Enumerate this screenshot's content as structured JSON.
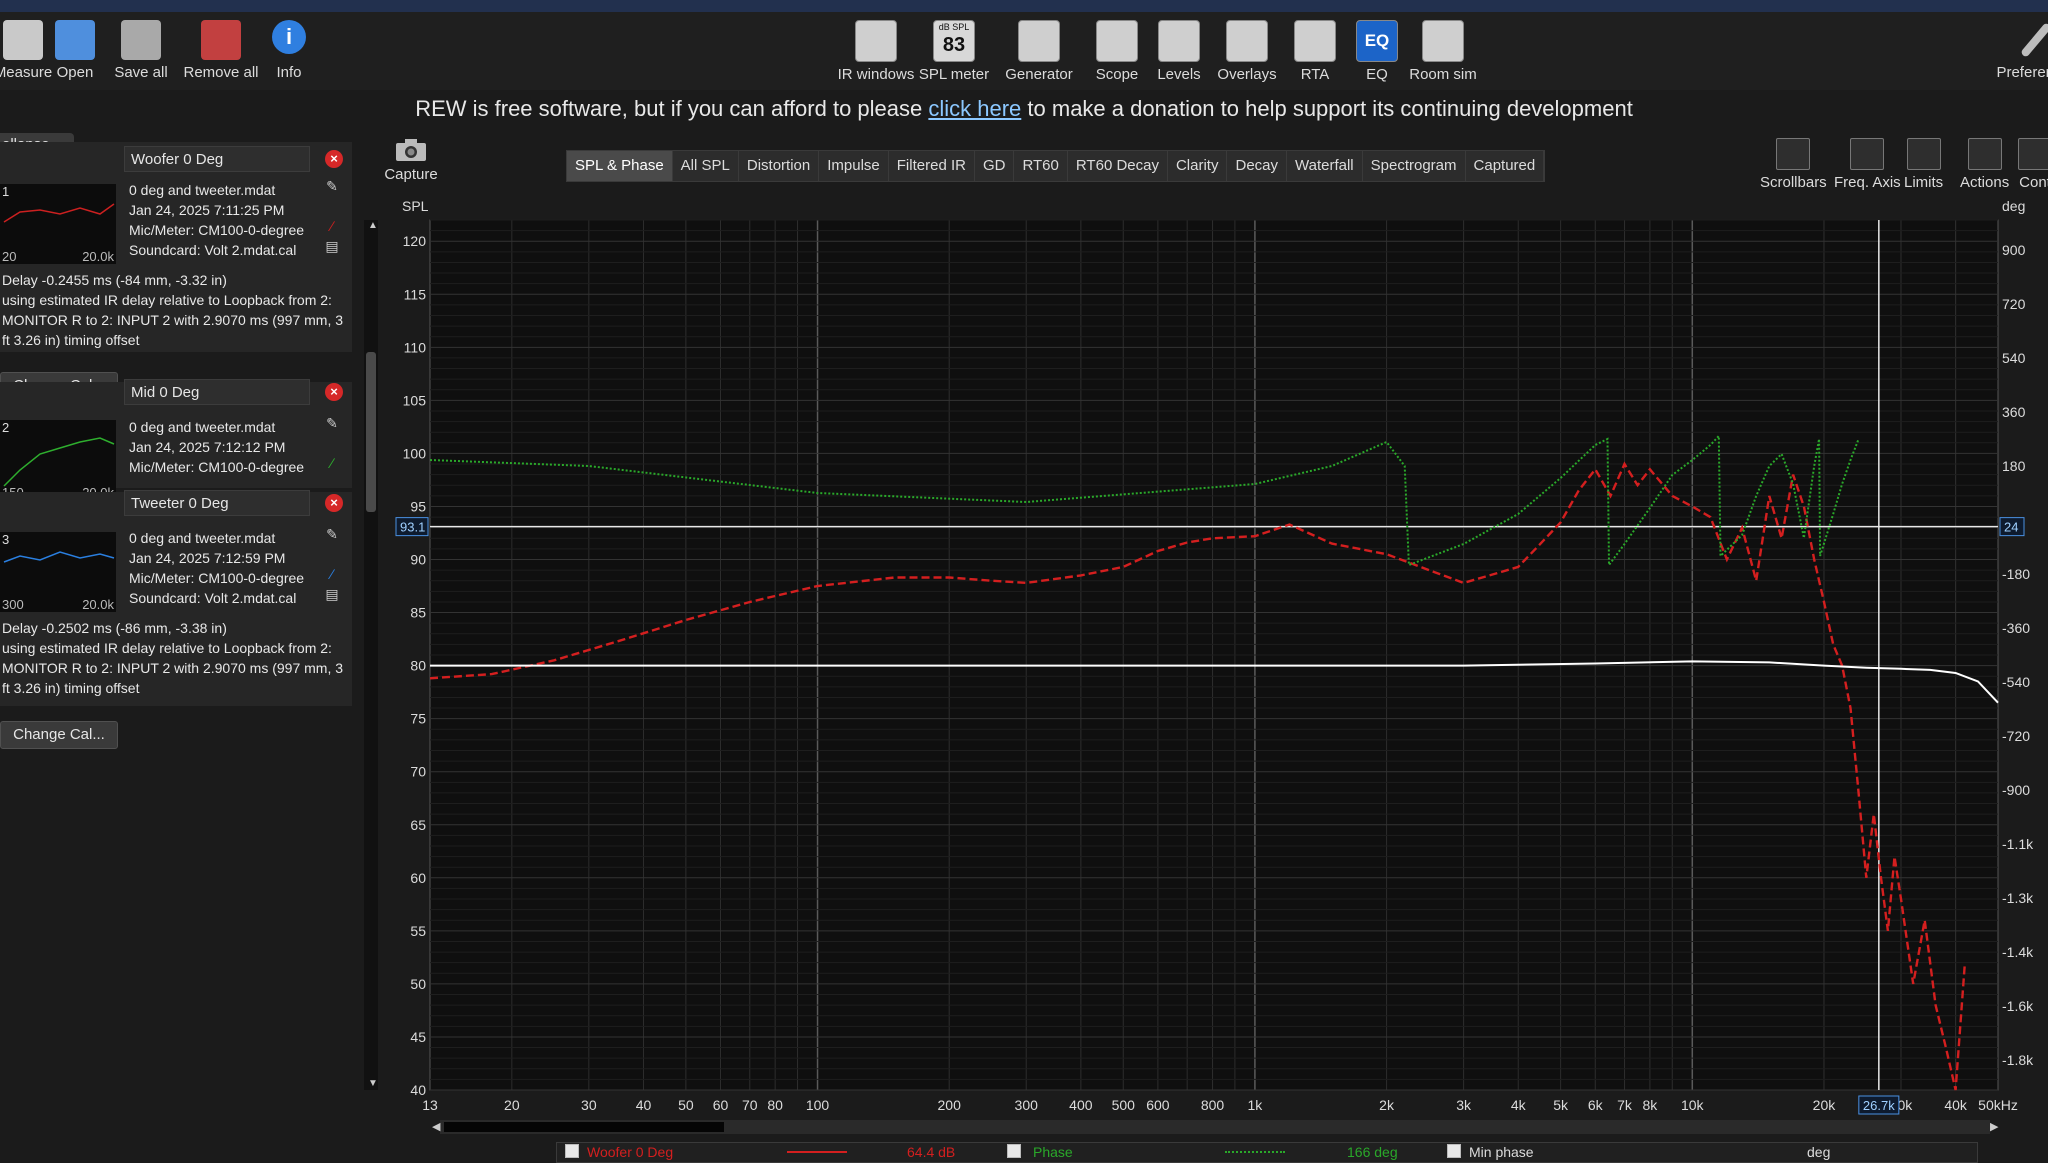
{
  "toolbar": {
    "left": [
      {
        "label": "Measure",
        "icon": "measure-icon"
      },
      {
        "label": "Open",
        "icon": "folder-icon"
      },
      {
        "label": "Save all",
        "icon": "save-icon"
      },
      {
        "label": "Remove all",
        "icon": "remove-icon"
      },
      {
        "label": "Info",
        "icon": "info-icon"
      }
    ],
    "center": [
      {
        "label": "IR windows",
        "icon": "ir-windows-icon"
      },
      {
        "label": "SPL meter",
        "icon": "spl-meter-icon",
        "badge_top": "dB SPL",
        "badge_value": "83"
      },
      {
        "label": "Generator",
        "icon": "generator-icon"
      },
      {
        "label": "Scope",
        "icon": "scope-icon"
      },
      {
        "label": "Levels",
        "icon": "levels-icon"
      },
      {
        "label": "Overlays",
        "icon": "overlays-icon"
      },
      {
        "label": "RTA",
        "icon": "rta-icon"
      },
      {
        "label": "EQ",
        "icon": "eq-icon"
      },
      {
        "label": "Room sim",
        "icon": "room-sim-icon"
      }
    ],
    "right_cut": "Preferenc"
  },
  "donate": {
    "before": "REW is free software, but if you can afford to please ",
    "link": "click here",
    "after": " to make a donation to help support its continuing development"
  },
  "left_panel": {
    "collapse_label": "ollapse «",
    "change_cal_label": "Change Cal...",
    "measurements": [
      {
        "index": "1",
        "name": "Woofer 0 Deg",
        "thumb_lo": "20",
        "thumb_hi": "20.0k",
        "file": "0 deg and tweeter.mdat",
        "date": "Jan 24, 2025 7:11:25 PM",
        "mic": "Mic/Meter: CM100-0-degree",
        "soundcard": "Soundcard: Volt 2.mdat.cal",
        "delay": "Delay -0.2455 ms (-84 mm, -3.32 in)",
        "delay_note": "using estimated IR delay relative to Loopback from 2: MONITOR R to 2: INPUT 2 with 2.9070 ms (997 mm, 3 ft 3.26 in) timing offset",
        "color": "#cc2020"
      },
      {
        "index": "2",
        "name": "Mid 0 Deg",
        "thumb_lo": "150",
        "thumb_hi": "20.0k",
        "file": "0 deg and tweeter.mdat",
        "date": "Jan 24, 2025 7:12:12 PM",
        "mic": "Mic/Meter: CM100-0-degree",
        "color": "#2eae2e"
      },
      {
        "index": "3",
        "name": "Tweeter 0 Deg",
        "thumb_lo": "300",
        "thumb_hi": "20.0k",
        "file": "0 deg and tweeter.mdat",
        "date": "Jan 24, 2025 7:12:59 PM",
        "mic": "Mic/Meter: CM100-0-degree",
        "soundcard": "Soundcard: Volt 2.mdat.cal",
        "delay": "Delay -0.2502 ms (-86 mm, -3.38 in)",
        "delay_note": "using estimated IR delay relative to Loopback from 2: MONITOR R to 2: INPUT 2 with 2.9070 ms (997 mm, 3 ft 3.26 in) timing offset",
        "color": "#2a7fe0"
      }
    ]
  },
  "graph_toolbar": {
    "capture_label": "Capture",
    "tabs": [
      "SPL & Phase",
      "All SPL",
      "Distortion",
      "Impulse",
      "Filtered IR",
      "GD",
      "RT60",
      "RT60 Decay",
      "Clarity",
      "Decay",
      "Waterfall",
      "Spectrogram",
      "Captured"
    ],
    "active_tab": "SPL & Phase",
    "right_buttons": [
      {
        "label": "Scrollbars",
        "icon": "scrollbars-icon"
      },
      {
        "label": "Freq. Axis",
        "icon": "freq-axis-icon"
      },
      {
        "label": "Limits",
        "icon": "limits-icon"
      },
      {
        "label": "Actions",
        "icon": "actions-icon"
      },
      {
        "label": "Cont",
        "icon": "controls-icon"
      }
    ]
  },
  "chart_data": {
    "type": "line",
    "x_scale": "log",
    "xlim": [
      13,
      50000
    ],
    "ylim": [
      40,
      122
    ],
    "ylabel": "SPL",
    "y2label": "deg",
    "y2lim": [
      -1900,
      1000
    ],
    "grid": true,
    "x_tick_labels": [
      {
        "f": 13,
        "label": "13"
      },
      {
        "f": 20,
        "label": "20"
      },
      {
        "f": 30,
        "label": "30"
      },
      {
        "f": 40,
        "label": "40"
      },
      {
        "f": 50,
        "label": "50"
      },
      {
        "f": 60,
        "label": "60"
      },
      {
        "f": 70,
        "label": "70"
      },
      {
        "f": 80,
        "label": "80"
      },
      {
        "f": 100,
        "label": "100"
      },
      {
        "f": 200,
        "label": "200"
      },
      {
        "f": 300,
        "label": "300"
      },
      {
        "f": 400,
        "label": "400"
      },
      {
        "f": 500,
        "label": "500"
      },
      {
        "f": 600,
        "label": "600"
      },
      {
        "f": 800,
        "label": "800"
      },
      {
        "f": 1000,
        "label": "1k"
      },
      {
        "f": 2000,
        "label": "2k"
      },
      {
        "f": 3000,
        "label": "3k"
      },
      {
        "f": 4000,
        "label": "4k"
      },
      {
        "f": 5000,
        "label": "5k"
      },
      {
        "f": 6000,
        "label": "6k"
      },
      {
        "f": 7000,
        "label": "7k"
      },
      {
        "f": 8000,
        "label": "8k"
      },
      {
        "f": 10000,
        "label": "10k"
      },
      {
        "f": 20000,
        "label": "20k"
      },
      {
        "f": 30000,
        "label": "30k"
      },
      {
        "f": 40000,
        "label": "40k"
      },
      {
        "f": 50000,
        "label": "50kHz"
      }
    ],
    "y_ticks": [
      120,
      115,
      110,
      105,
      100,
      95,
      90,
      85,
      80,
      75,
      70,
      65,
      60,
      55,
      50,
      45,
      40
    ],
    "y2_ticks": [
      {
        "v": 900,
        "label": "900"
      },
      {
        "v": 720,
        "label": "720"
      },
      {
        "v": 540,
        "label": "540"
      },
      {
        "v": 360,
        "label": "360"
      },
      {
        "v": 180,
        "label": "180"
      },
      {
        "v": -180,
        "label": "-180"
      },
      {
        "v": -360,
        "label": "-360"
      },
      {
        "v": -540,
        "label": "-540"
      },
      {
        "v": -720,
        "label": "-720"
      },
      {
        "v": -900,
        "label": "-900"
      },
      {
        "v": -1080,
        "label": "-1.1k"
      },
      {
        "v": -1260,
        "label": "-1.3k"
      },
      {
        "v": -1440,
        "label": "-1.4k"
      },
      {
        "v": -1620,
        "label": "-1.6k"
      },
      {
        "v": -1800,
        "label": "-1.8k"
      }
    ],
    "series": [
      {
        "name": "Woofer 0 Deg",
        "axis": "spl",
        "color": "#d41f1f",
        "style": "solid",
        "x": [
          13,
          18,
          25,
          35,
          50,
          70,
          100,
          150,
          200,
          250,
          300,
          400,
          500,
          600,
          700,
          800,
          1000,
          1200,
          1500,
          2000,
          2500,
          3000,
          3500,
          4000,
          4500,
          5000,
          5500,
          6000,
          6500,
          7000,
          7500,
          8000,
          9000,
          10000,
          11000,
          12000,
          13000,
          14000,
          15000,
          16000,
          17000,
          18000,
          19000,
          20000,
          21000,
          22000,
          23000,
          24000,
          25000,
          26000,
          27000,
          28000,
          29000,
          30000,
          32000,
          34000,
          36000,
          38000,
          40000,
          42000
        ],
        "y": [
          78.8,
          79.2,
          80.5,
          82.3,
          84.3,
          86,
          87.5,
          88.3,
          88.3,
          88,
          87.8,
          88.5,
          89.3,
          90.8,
          91.6,
          92,
          92.2,
          93.3,
          91.5,
          90.5,
          89,
          87.8,
          88.6,
          89.3,
          91.5,
          93.5,
          96.5,
          98.5,
          96,
          99,
          97,
          98.5,
          96,
          95,
          94,
          90,
          93,
          88,
          96,
          92,
          98,
          95,
          90,
          86,
          82,
          80,
          76,
          68,
          60,
          66,
          60,
          55,
          62,
          58,
          50,
          56,
          48,
          44,
          40,
          52
        ]
      },
      {
        "name": "Phase",
        "axis": "deg",
        "color": "#2aa82a",
        "style": "dotted",
        "x": [
          13,
          30,
          100,
          300,
          1000,
          1500,
          2000,
          2200,
          2250,
          3000,
          4000,
          5000,
          6000,
          6400,
          6450,
          7000,
          8000,
          9000,
          10000,
          11000,
          11500,
          11600,
          13000,
          14000,
          15000,
          16000,
          17000,
          18000,
          19000,
          19500,
          19600,
          21000,
          22000,
          23000,
          24000
        ],
        "y": [
          200,
          180,
          90,
          60,
          120,
          180,
          260,
          180,
          -150,
          -80,
          20,
          140,
          250,
          270,
          -150,
          -80,
          40,
          150,
          200,
          250,
          280,
          -120,
          -50,
          80,
          180,
          220,
          120,
          -60,
          180,
          270,
          -120,
          20,
          120,
          200,
          270
        ]
      },
      {
        "name": "Min phase",
        "axis": "spl",
        "color": "#ffffff",
        "style": "solid",
        "x": [
          13,
          100,
          1000,
          3000,
          6000,
          10000,
          15000,
          20000,
          25000,
          30000,
          35000,
          40000,
          45000,
          50000
        ],
        "y": [
          80,
          80,
          80,
          80,
          80.2,
          80.4,
          80.3,
          80,
          79.8,
          79.7,
          79.6,
          79.3,
          78.5,
          76.5
        ]
      }
    ],
    "cursor": {
      "spl_label": "93.1",
      "deg_label": "24",
      "freq_label": "26.7k",
      "freq": 26700,
      "spl": 93.1
    }
  },
  "legend": {
    "items": [
      {
        "label": "Woofer 0 Deg",
        "value": "64.4 dB",
        "color": "#d41f1f"
      },
      {
        "label": "Phase",
        "value": "166 deg",
        "color": "#2aa82a"
      },
      {
        "label": "Min phase",
        "value": "deg",
        "color": "#dcdcdc"
      }
    ]
  }
}
